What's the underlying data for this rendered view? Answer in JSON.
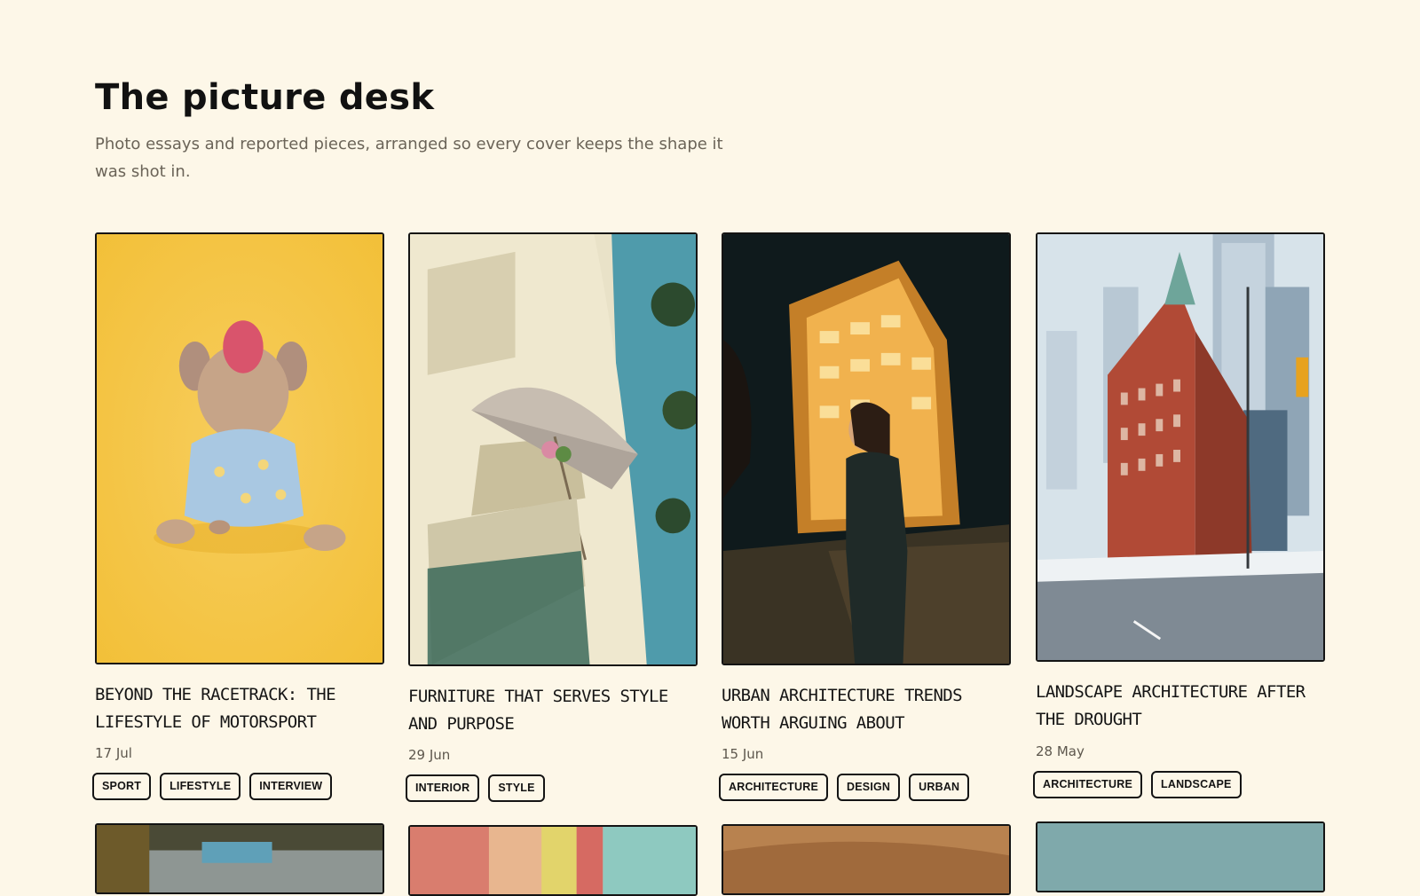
{
  "header": {
    "title": "The picture desk",
    "subtitle": "Photo essays and reported pieces, arranged so every cover keeps the shape it was shot in."
  },
  "articles": [
    {
      "title": "BEYOND THE RACETRACK: THE LIFESTYLE OF MOTORSPORT",
      "date": "17 Jul",
      "tags": [
        "SPORT",
        "LIFESTYLE",
        "INTERVIEW"
      ],
      "cover": "puppy on yellow backdrop"
    },
    {
      "title": "FURNITURE THAT SERVES STYLE AND PURPOSE",
      "date": "29 Jun",
      "tags": [
        "INTERIOR",
        "STYLE"
      ],
      "cover": "balcony with umbrella"
    },
    {
      "title": "URBAN ARCHITECTURE TRENDS WORTH ARGUING ABOUT",
      "date": "15 Jun",
      "tags": [
        "ARCHITECTURE",
        "DESIGN",
        "URBAN"
      ],
      "cover": "lit building at night"
    },
    {
      "title": "LANDSCAPE ARCHITECTURE AFTER THE DROUGHT",
      "date": "28 May",
      "tags": [
        "ARCHITECTURE",
        "LANDSCAPE"
      ],
      "cover": "red brick flatiron building"
    }
  ],
  "colors": {
    "background": "#fdf7e8",
    "ink": "#141414",
    "muted": "#6b6458"
  }
}
